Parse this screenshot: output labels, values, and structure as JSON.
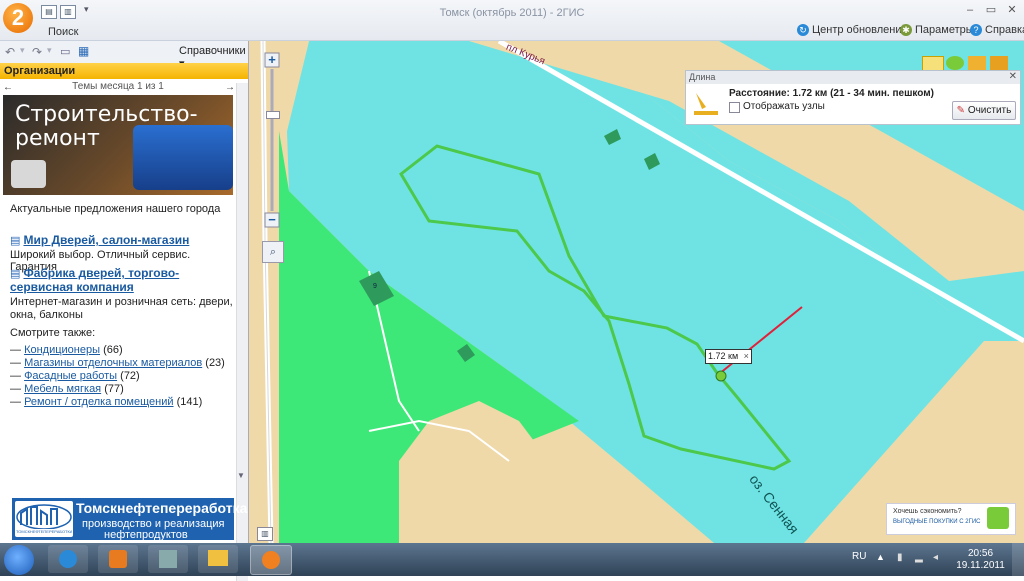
{
  "window": {
    "title": "Томск (октябрь 2011) - 2ГИС",
    "logo_text": "2",
    "search_tab": "Поиск",
    "update_center": "Центр обновлений",
    "settings": "Параметры",
    "help": "Справка"
  },
  "sidebar": {
    "directories_label": "Справочники",
    "section_title": "Организации",
    "month_topics": "Темы месяца 1 из 1",
    "banner_title": "Строительство-ремонт",
    "intro": "Актуальные предложения нашего города",
    "listings": [
      {
        "name": "Мир Дверей, салон-магазин",
        "desc": "Широкий выбор. Отличный сервис. Гарантия"
      },
      {
        "name": "Фабрика дверей, торгово-сервисная компания",
        "desc": "Интернет-магазин и розничная сеть: двери, окна, балконы"
      }
    ],
    "see_also_label": "Смотрите также:",
    "see_also": [
      {
        "label": "Кондиционеры",
        "count": "(66)"
      },
      {
        "label": "Магазины отделочных материалов",
        "count": "(23)"
      },
      {
        "label": "Фасадные работы",
        "count": "(72)"
      },
      {
        "label": "Мебель мягкая",
        "count": "(77)"
      },
      {
        "label": "Ремонт / отделка помещений",
        "count": "(141)"
      }
    ],
    "ad_title": "Томскнефтепереработка",
    "ad_line1": "производство и реализация",
    "ad_line2": "нефтепродуктов",
    "ad_small": "ТОМСКНЕФТЕПЕРЕРАБОТКА"
  },
  "map": {
    "street_label": "пл Курья",
    "lake_label": "оз. Сенная",
    "distance_marker": "1.72 км",
    "building_number": "9"
  },
  "length_panel": {
    "header": "Длина",
    "distance_text": "Расстояние: 1.72 км (21 - 34 мин. пешком)",
    "show_nodes": "Отображать узлы",
    "clear_button": "Очистить"
  },
  "promo": {
    "line1": "Хочешь сэкономить?",
    "line2": "ВЫГОДНЫЕ ПОКУПКИ С 2ГИС"
  },
  "taskbar": {
    "language": "RU",
    "time": "20:56",
    "date": "19.11.2011"
  },
  "colors": {
    "water": "#6fe3e3",
    "sand": "#f0d9a8",
    "forest": "#3ee878",
    "route": "#4cc84a",
    "accent": "#f5b300"
  }
}
